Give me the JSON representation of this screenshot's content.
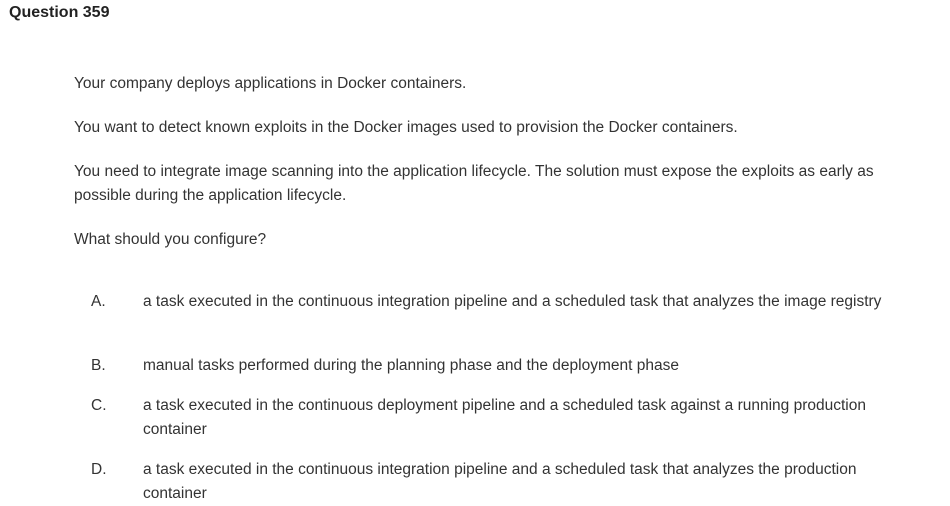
{
  "question": {
    "title": "Question 359",
    "stem": [
      "Your company deploys applications in Docker containers.",
      "You want to detect known exploits in the Docker images used to provision the Docker containers.",
      "You need to integrate image scanning into the application lifecycle. The solution must expose the exploits as early as possible during the application lifecycle.",
      "What should you configure?"
    ],
    "options": [
      {
        "letter": "A.",
        "text": "a task executed in the continuous integration pipeline and a scheduled task that analyzes the image registry"
      },
      {
        "letter": "B.",
        "text": "manual tasks performed during the planning phase and the deployment phase"
      },
      {
        "letter": "C.",
        "text": "a task executed in the continuous deployment pipeline and a scheduled task against a running production container"
      },
      {
        "letter": "D.",
        "text": "a task executed in the continuous integration pipeline and a scheduled task that analyzes the production container"
      }
    ]
  }
}
